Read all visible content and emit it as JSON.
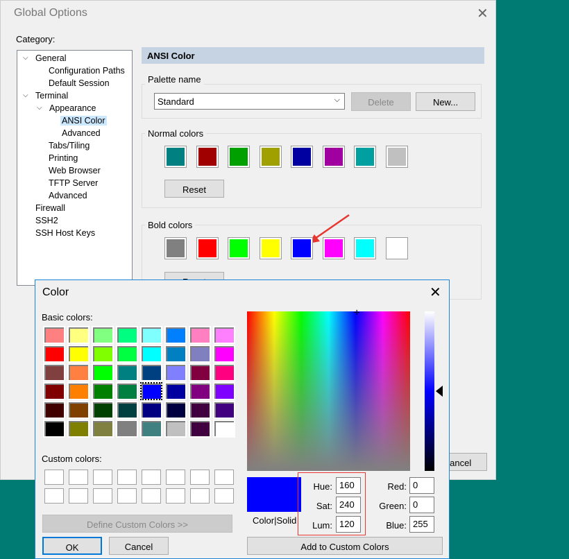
{
  "global_options": {
    "title": "Global Options",
    "category_label": "Category:",
    "tree": [
      {
        "label": "General",
        "level": 0,
        "expanded": true
      },
      {
        "label": "Configuration Paths",
        "level": 2
      },
      {
        "label": "Default Session",
        "level": 2
      },
      {
        "label": "Terminal",
        "level": 0,
        "expanded": true
      },
      {
        "label": "Appearance",
        "level": 1,
        "expanded": true
      },
      {
        "label": "ANSI Color",
        "level": 3,
        "selected": true
      },
      {
        "label": "Advanced",
        "level": 3
      },
      {
        "label": "Tabs/Tiling",
        "level": 2
      },
      {
        "label": "Printing",
        "level": 2
      },
      {
        "label": "Web Browser",
        "level": 2
      },
      {
        "label": "TFTP Server",
        "level": 2
      },
      {
        "label": "Advanced",
        "level": 2
      },
      {
        "label": "Firewall",
        "level": 0
      },
      {
        "label": "SSH2",
        "level": 0
      },
      {
        "label": "SSH Host Keys",
        "level": 0
      }
    ],
    "panel_title": "ANSI Color",
    "palette_label": "Palette name",
    "palette_value": "Standard",
    "delete_label": "Delete",
    "new_label": "New...",
    "normal_label": "Normal colors",
    "normal_colors": [
      "#008080",
      "#A00000",
      "#00A000",
      "#A0A000",
      "#0000A0",
      "#A000A0",
      "#00A0A0",
      "#C0C0C0"
    ],
    "reset_label": "Reset",
    "bold_label": "Bold colors",
    "bold_colors": [
      "#808080",
      "#FF0000",
      "#00FF00",
      "#FFFF00",
      "#0000FF",
      "#FF00FF",
      "#00FFFF",
      "#FFFFFF"
    ],
    "cancel_label": "Cancel"
  },
  "color_dialog": {
    "title": "Color",
    "basic_label": "Basic colors:",
    "custom_label": "Custom colors:",
    "basic_colors": [
      "#FF8080",
      "#FFFF80",
      "#80FF80",
      "#00FF80",
      "#80FFFF",
      "#0080FF",
      "#FF80C0",
      "#FF80FF",
      "#FF0000",
      "#FFFF00",
      "#80FF00",
      "#00FF40",
      "#00FFFF",
      "#0080C0",
      "#8080C0",
      "#FF00FF",
      "#804040",
      "#FF8040",
      "#00FF00",
      "#008080",
      "#004080",
      "#8080FF",
      "#800040",
      "#FF0080",
      "#800000",
      "#FF8000",
      "#008000",
      "#008040",
      "#0000FF",
      "#0000A0",
      "#800080",
      "#8000FF",
      "#400000",
      "#804000",
      "#004000",
      "#004040",
      "#000080",
      "#000040",
      "#400040",
      "#400080",
      "#000000",
      "#808000",
      "#808040",
      "#808080",
      "#408080",
      "#C0C0C0",
      "#400040",
      "#FFFFFF"
    ],
    "selected_basic": "#0000FF",
    "define_label": "Define Custom Colors >>",
    "ok_label": "OK",
    "cancel_label": "Cancel",
    "color_solid_label": "Color|Solid",
    "preview_color": "#0000FF",
    "hue_label": "Hue:",
    "hue": "160",
    "sat_label": "Sat:",
    "sat": "240",
    "lum_label": "Lum:",
    "lum": "120",
    "red_label": "Red:",
    "red": "0",
    "green_label": "Green:",
    "green": "0",
    "blue_label": "Blue:",
    "blue": "255",
    "add_label": "Add to Custom Colors",
    "luminance_level": 0.5
  }
}
